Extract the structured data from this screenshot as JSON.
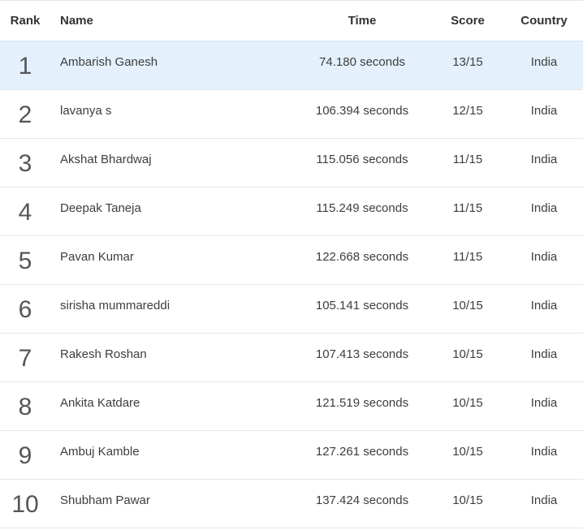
{
  "colors": {
    "highlight_row": "#e4f1fd",
    "divider": "#e6e6e6",
    "text": "#333333"
  },
  "table": {
    "headers": {
      "rank": "Rank",
      "name": "Name",
      "time": "Time",
      "score": "Score",
      "country": "Country"
    },
    "rows": [
      {
        "rank": "1",
        "name": "Ambarish Ganesh",
        "time": "74.180 seconds",
        "score": "13/15",
        "country": "India"
      },
      {
        "rank": "2",
        "name": "lavanya s",
        "time": "106.394 seconds",
        "score": "12/15",
        "country": "India"
      },
      {
        "rank": "3",
        "name": "Akshat Bhardwaj",
        "time": "115.056 seconds",
        "score": "11/15",
        "country": "India"
      },
      {
        "rank": "4",
        "name": "Deepak Taneja",
        "time": "115.249 seconds",
        "score": "11/15",
        "country": "India"
      },
      {
        "rank": "5",
        "name": "Pavan Kumar",
        "time": "122.668 seconds",
        "score": "11/15",
        "country": "India"
      },
      {
        "rank": "6",
        "name": "sirisha mummareddi",
        "time": "105.141 seconds",
        "score": "10/15",
        "country": "India"
      },
      {
        "rank": "7",
        "name": "Rakesh Roshan",
        "time": "107.413 seconds",
        "score": "10/15",
        "country": "India"
      },
      {
        "rank": "8",
        "name": "Ankita Katdare",
        "time": "121.519 seconds",
        "score": "10/15",
        "country": "India"
      },
      {
        "rank": "9",
        "name": "Ambuj Kamble",
        "time": "127.261 seconds",
        "score": "10/15",
        "country": "India"
      },
      {
        "rank": "10",
        "name": "Shubham Pawar",
        "time": "137.424 seconds",
        "score": "10/15",
        "country": "India"
      }
    ]
  }
}
